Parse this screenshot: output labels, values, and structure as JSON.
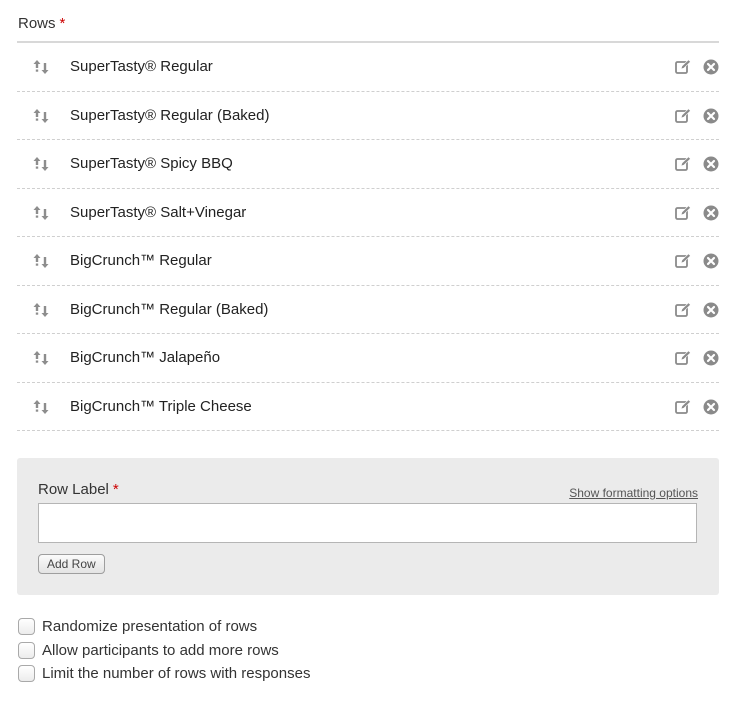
{
  "rows_section": {
    "label": "Rows",
    "required_mark": "*",
    "items": [
      {
        "label": "SuperTasty® Regular"
      },
      {
        "label": "SuperTasty® Regular (Baked)"
      },
      {
        "label": "SuperTasty® Spicy BBQ"
      },
      {
        "label": "SuperTasty® Salt+Vinegar"
      },
      {
        "label": "BigCrunch™ Regular"
      },
      {
        "label": "BigCrunch™ Regular (Baked)"
      },
      {
        "label": "BigCrunch™ Jalapeño"
      },
      {
        "label": "BigCrunch™ Triple Cheese"
      }
    ],
    "icons": {
      "drag": "sort-arrows-icon",
      "edit": "edit-icon",
      "delete": "close-circle-icon"
    }
  },
  "row_form": {
    "label": "Row Label",
    "required_mark": "*",
    "format_link": "Show formatting options",
    "input_value": "",
    "add_button": "Add Row"
  },
  "options": [
    {
      "label": "Randomize presentation of rows",
      "checked": false
    },
    {
      "label": "Allow participants to add more rows",
      "checked": false
    },
    {
      "label": "Limit the number of rows with responses",
      "checked": false
    }
  ],
  "colors": {
    "required": "#cc0000",
    "panel_bg": "#ebebeb",
    "icon": "#8a8a8a"
  }
}
